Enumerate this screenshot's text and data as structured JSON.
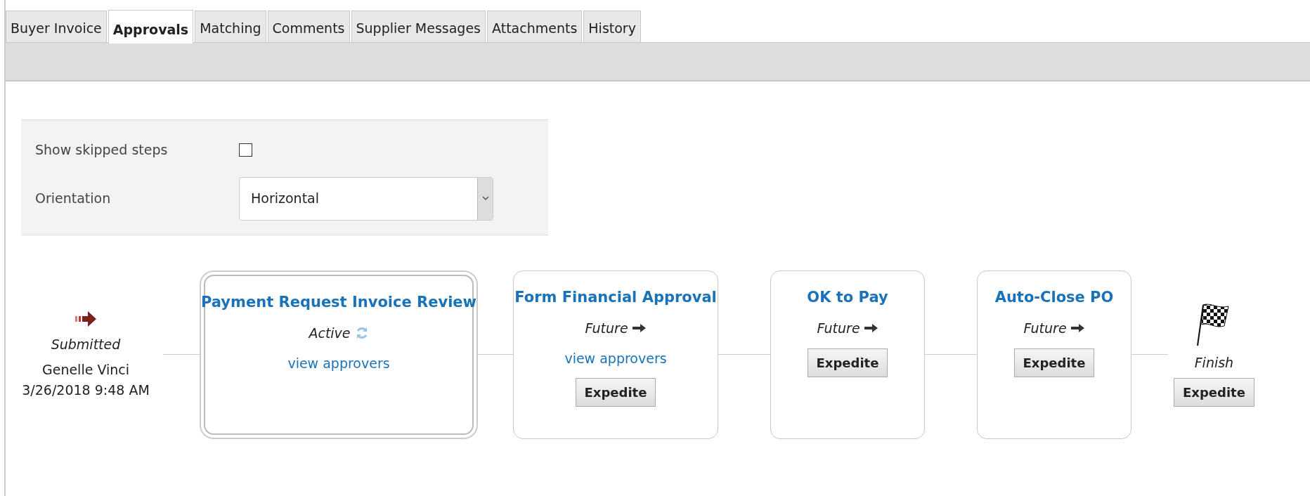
{
  "tabs": [
    {
      "label": "Buyer Invoice",
      "selected": false
    },
    {
      "label": "Approvals",
      "selected": true
    },
    {
      "label": "Matching",
      "selected": false
    },
    {
      "label": "Comments",
      "selected": false
    },
    {
      "label": "Supplier Messages",
      "selected": false
    },
    {
      "label": "Attachments",
      "selected": false
    },
    {
      "label": "History",
      "selected": false
    }
  ],
  "options": {
    "show_skipped": {
      "label": "Show skipped steps",
      "checked": false
    },
    "orientation": {
      "label": "Orientation",
      "value": "Horizontal"
    }
  },
  "workflow": {
    "start": {
      "status": "Submitted",
      "person": "Genelle Vinci",
      "date": "3/26/2018 9:48 AM"
    },
    "steps": [
      {
        "title": "Payment Request Invoice Review",
        "status": "Active",
        "kind": "active",
        "link": "view approvers"
      },
      {
        "title": "Form Financial Approval",
        "status": "Future",
        "kind": "future",
        "link": "view approvers",
        "button": "Expedite"
      },
      {
        "title": "OK to Pay",
        "status": "Future",
        "kind": "future",
        "button": "Expedite"
      },
      {
        "title": "Auto-Close PO",
        "status": "Future",
        "kind": "future",
        "button": "Expedite"
      }
    ],
    "finish": {
      "label": "Finish",
      "button": "Expedite"
    }
  }
}
